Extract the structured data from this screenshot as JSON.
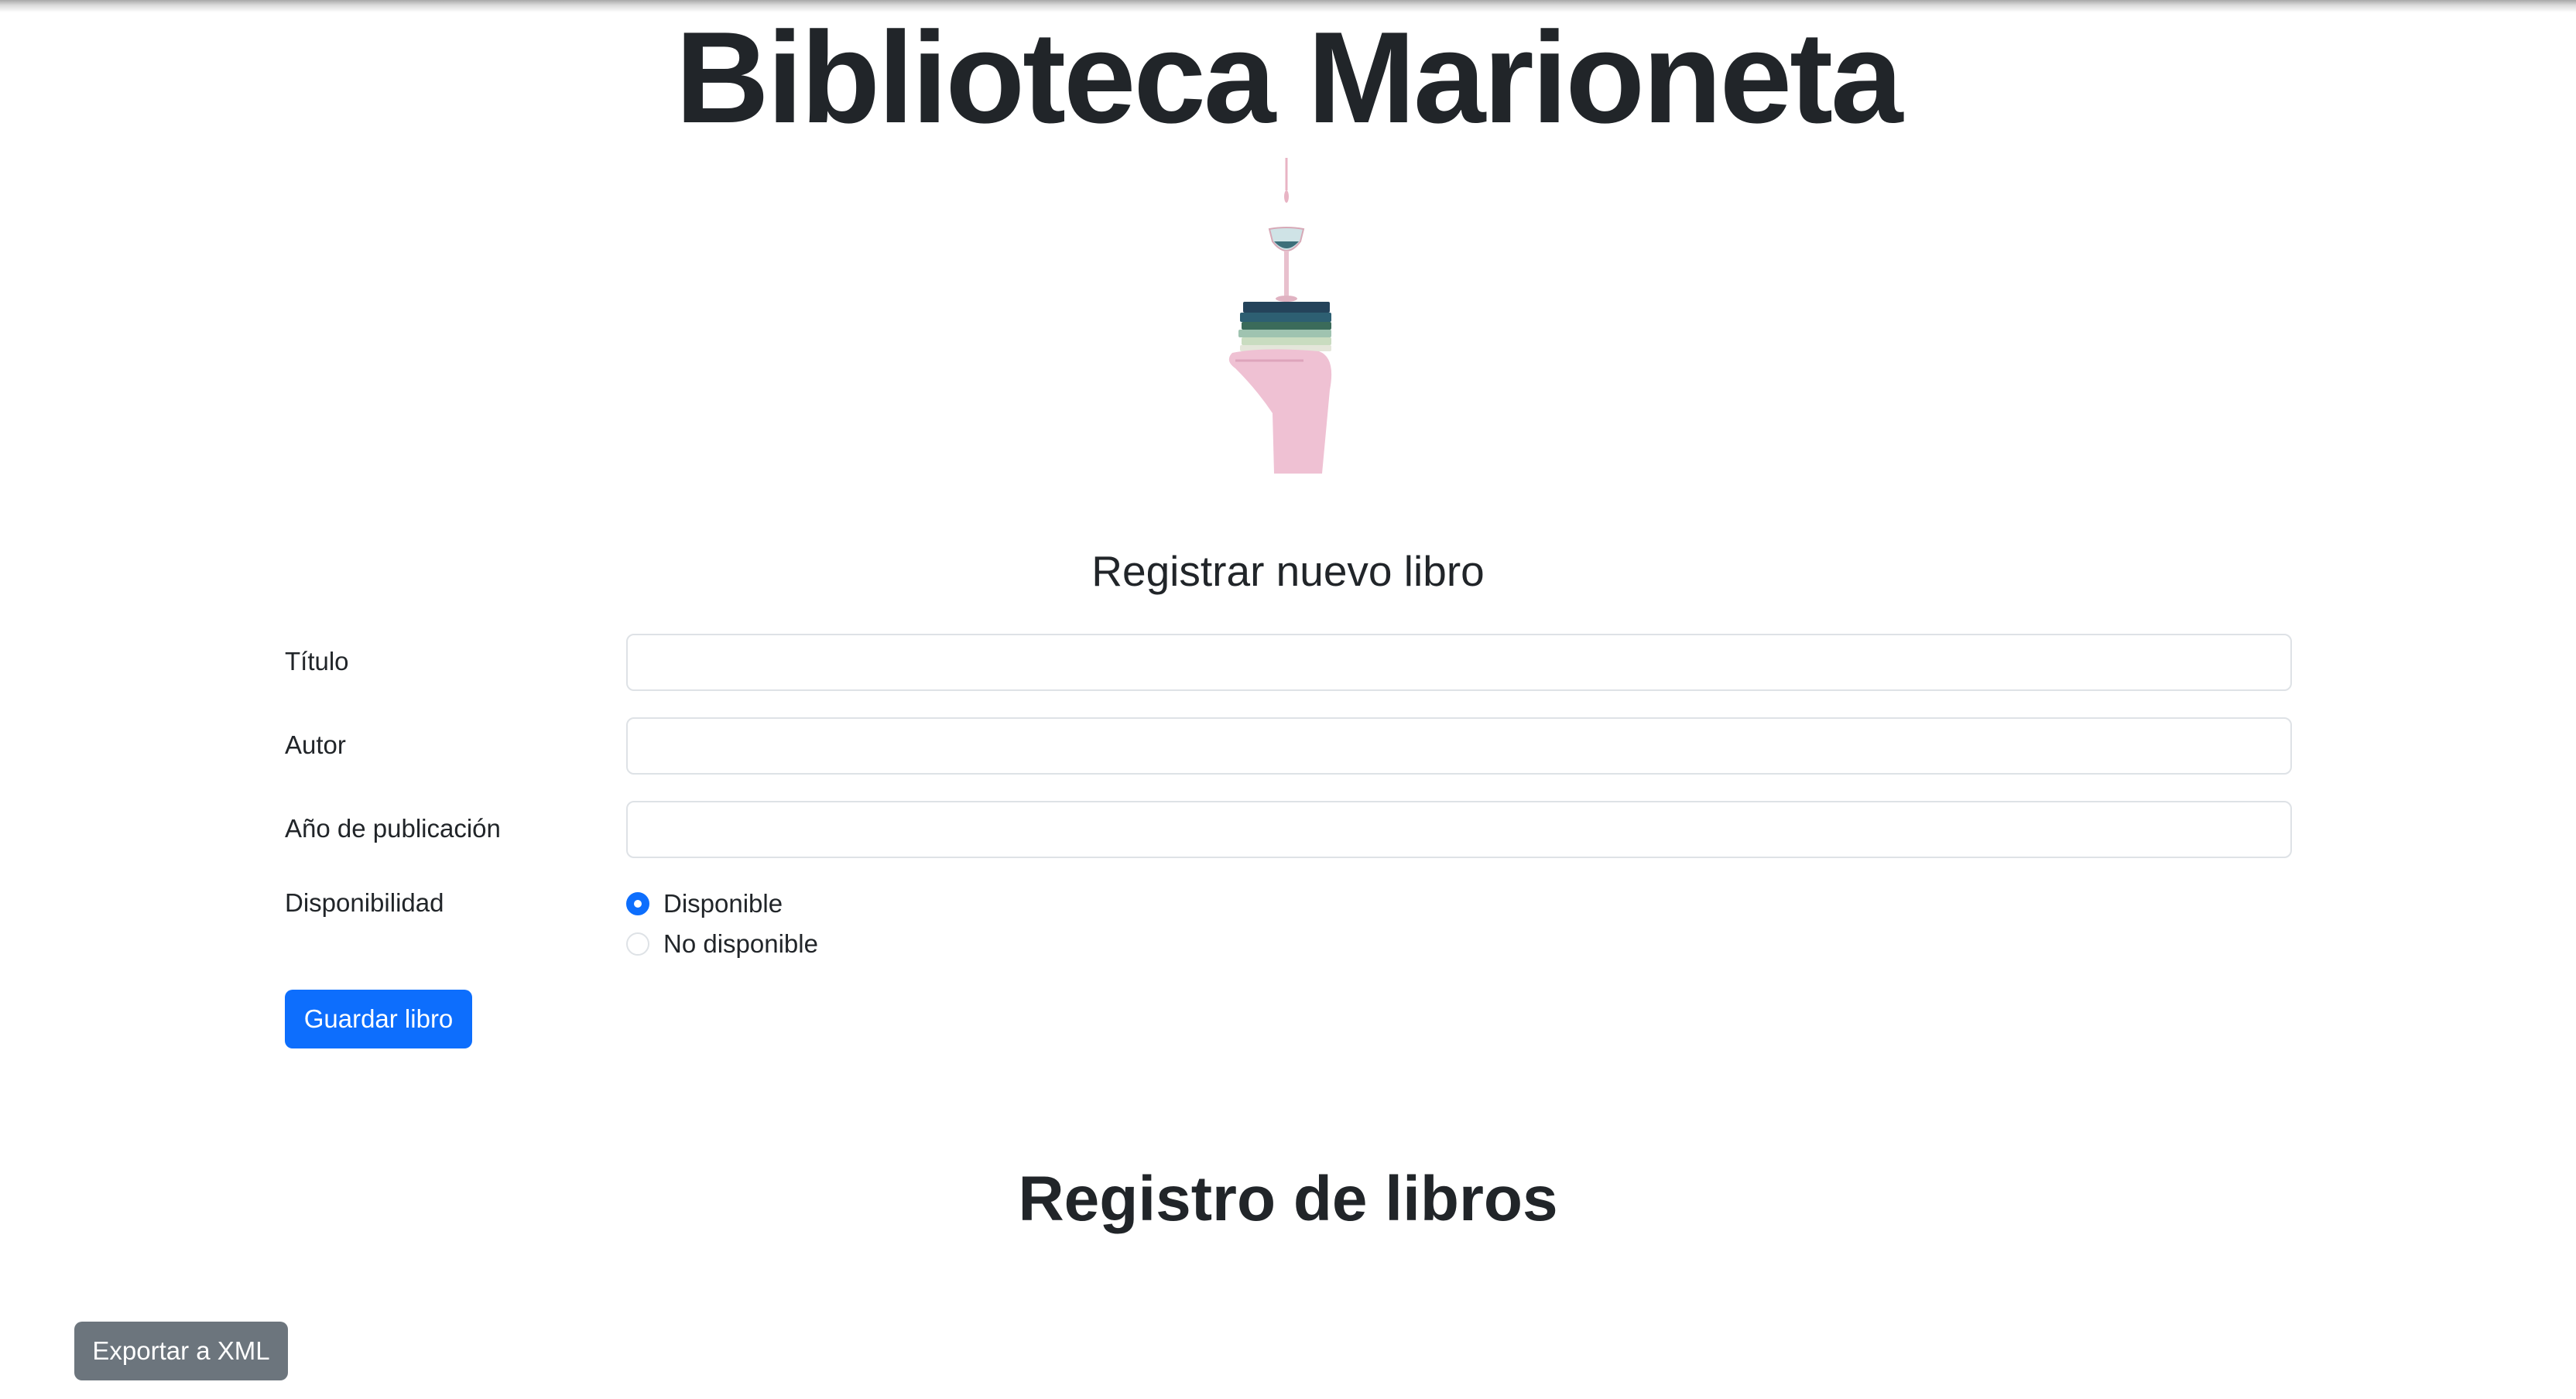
{
  "site": {
    "title": "Biblioteca Marioneta"
  },
  "hero_image": {
    "alt": "hand holding stack of books and a glass"
  },
  "form": {
    "title": "Registrar nuevo libro",
    "fields": {
      "titulo": {
        "label": "Título",
        "value": "",
        "placeholder": ""
      },
      "autor": {
        "label": "Autor",
        "value": "",
        "placeholder": ""
      },
      "anio": {
        "label": "Año de publicación",
        "value": "",
        "placeholder": ""
      }
    },
    "availability": {
      "label": "Disponibilidad",
      "options": [
        {
          "label": "Disponible",
          "checked": true
        },
        {
          "label": "No disponible",
          "checked": false
        }
      ]
    },
    "submit_label": "Guardar libro"
  },
  "records": {
    "title": "Registro de libros"
  },
  "export": {
    "label": "Exportar a XML"
  },
  "colors": {
    "primary": "#0d6efd",
    "secondary": "#6c757d",
    "text": "#212529",
    "border": "#dee2e6"
  }
}
